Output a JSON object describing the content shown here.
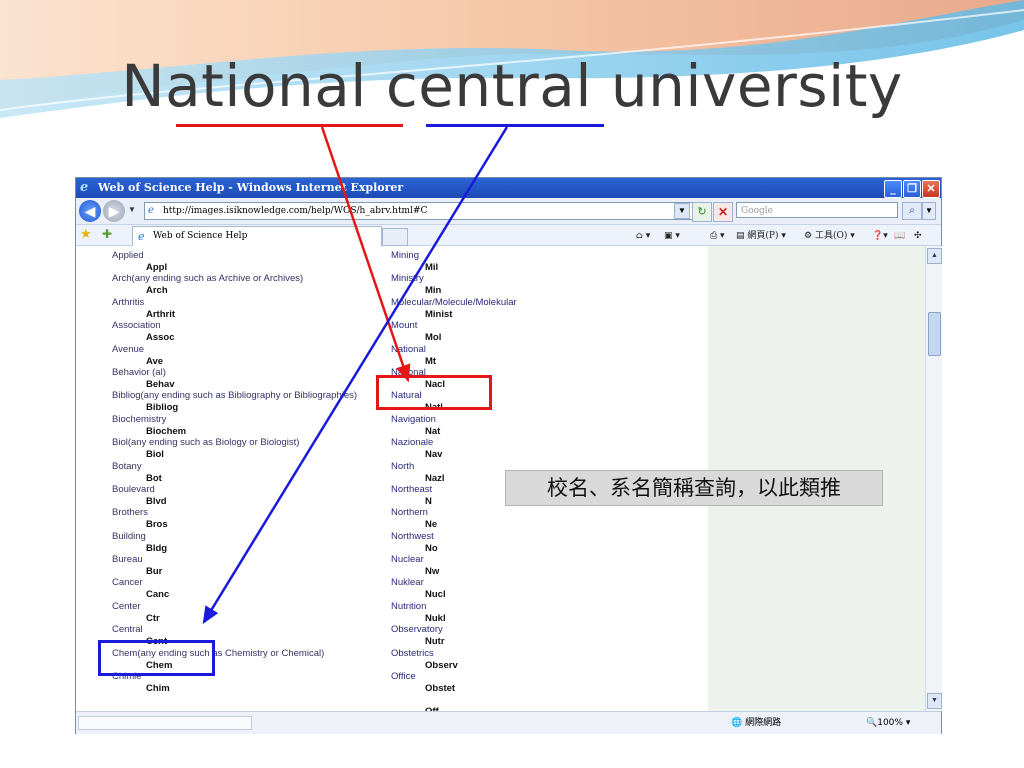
{
  "slide": {
    "title": "National central university",
    "note": "校名、系名簡稱查詢，以此類推"
  },
  "browser": {
    "window_title": "Web of Science Help - Windows Internet Explorer",
    "address": "http://images.isiknowledge.com/help/WOS/h_abrv.html#C",
    "search_placeholder": "Google",
    "tab_label": "Web of Science Help",
    "commands": {
      "page": "網頁(P)",
      "tools": "工具(O)"
    },
    "status_zone": "網際網路",
    "zoom": "100%"
  },
  "abbrev_left": [
    {
      "term": "Applied",
      "abbr": "Appl"
    },
    {
      "term": "Arch(any ending such as Archive or Archives)",
      "abbr": "Arch"
    },
    {
      "term": "Arthritis",
      "abbr": "Arthrit"
    },
    {
      "term": "Association",
      "abbr": "Assoc"
    },
    {
      "term": "Avenue",
      "abbr": "Ave"
    },
    {
      "term": "Behavior (al)",
      "abbr": "Behav"
    },
    {
      "term": "Bibliog(any ending such as Bibliography or Bibliographies)",
      "abbr": "Bibliog"
    },
    {
      "term": "Biochemistry",
      "abbr": "Biochem"
    },
    {
      "term": "Biol(any ending such as Biology or Biologist)",
      "abbr": "Biol"
    },
    {
      "term": "Botany",
      "abbr": "Bot"
    },
    {
      "term": "Boulevard",
      "abbr": "Blvd"
    },
    {
      "term": "Brothers",
      "abbr": "Bros"
    },
    {
      "term": "Building",
      "abbr": "Bldg"
    },
    {
      "term": "Bureau",
      "abbr": "Bur"
    },
    {
      "term": "Cancer",
      "abbr": "Canc"
    },
    {
      "term": "Center",
      "abbr": "Ctr"
    },
    {
      "term": "Central",
      "abbr": "Cent"
    },
    {
      "term": "Chem(any ending such as Chemistry or Chemical)",
      "abbr": "Chem"
    },
    {
      "term": "Chimie",
      "abbr": "Chim"
    }
  ],
  "abbrev_right": [
    {
      "term": "Mining",
      "abbr": "Mil"
    },
    {
      "term": "Ministry",
      "abbr": "Min"
    },
    {
      "term": "Molecular/Molecule/Molekular",
      "abbr": "Minist"
    },
    {
      "term": "Mount",
      "abbr": "Mol"
    },
    {
      "term": "National",
      "abbr": "Mt"
    },
    {
      "term": "National",
      "abbr": "Nacl"
    },
    {
      "term": "Natural",
      "abbr": "Natl"
    },
    {
      "term": "Navigation",
      "abbr": "Nat"
    },
    {
      "term": "Nazionale",
      "abbr": "Nav"
    },
    {
      "term": "North",
      "abbr": "Nazl"
    },
    {
      "term": "Northeast",
      "abbr": "N"
    },
    {
      "term": "Northern",
      "abbr": "Ne"
    },
    {
      "term": "Northwest",
      "abbr": "No"
    },
    {
      "term": "Nuclear",
      "abbr": "Nw"
    },
    {
      "term": "Nuklear",
      "abbr": "Nucl"
    },
    {
      "term": "Nutrition",
      "abbr": "Nukl"
    },
    {
      "term": "Observatory",
      "abbr": "Nutr"
    },
    {
      "term": "Obstetrics",
      "abbr": "Observ"
    },
    {
      "term": "Office",
      "abbr": "Obstet"
    },
    {
      "term": "",
      "abbr": "Off"
    }
  ],
  "colors": {
    "red_marker": "#e51616",
    "blue_marker": "#1a1adb"
  }
}
